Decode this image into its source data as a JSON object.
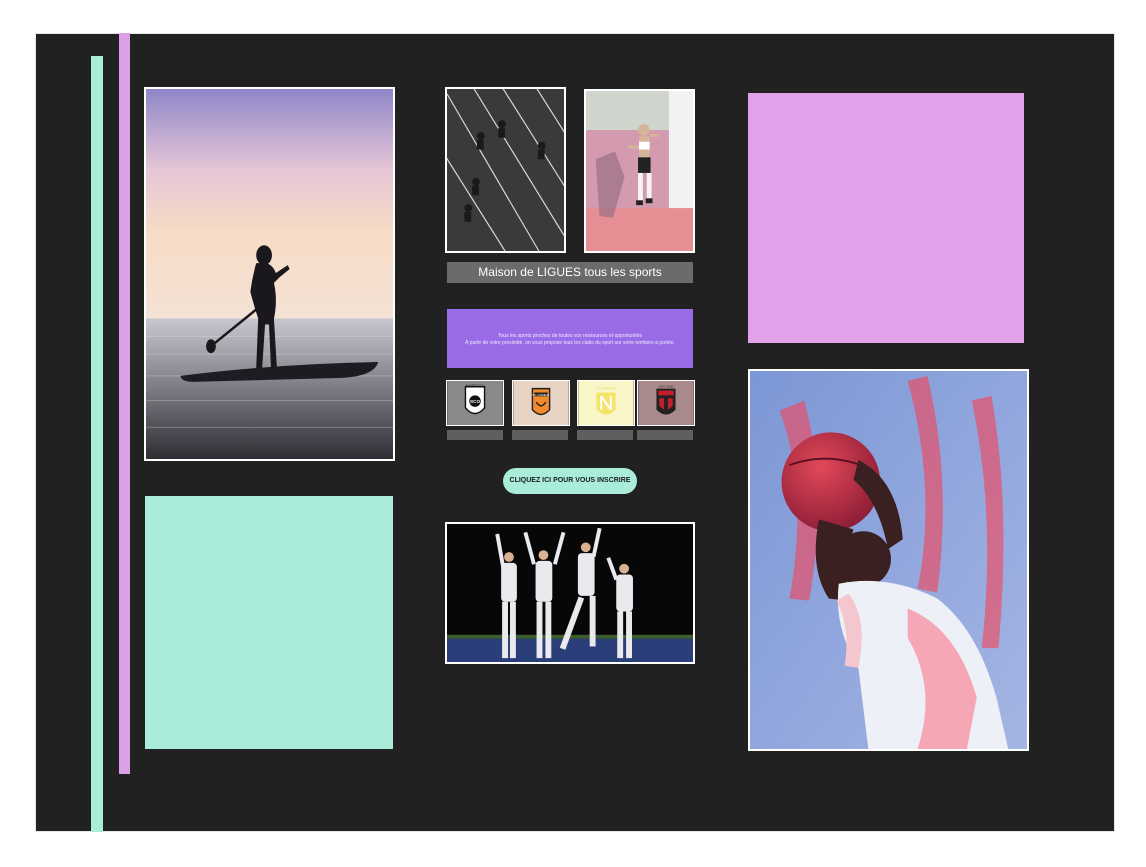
{
  "caption": {
    "text": "Maison de LIGUES tous les sports"
  },
  "info_panel": {
    "line1": "Tous les sports proches de toutes vos ressources et opportunités",
    "line2": "À partir de votre proximité, on vous propose tous les clubs du sport sur votre territoire à portée."
  },
  "club_logos": {
    "angers_text": "ANGERS SCO",
    "lorient_text": "FC LORIENT",
    "nantes_text": "FC NANTES",
    "nice_text": "OGC NICE"
  },
  "cta": {
    "label": "CLIQUEZ ICI POUR VOUS INSCRIRE"
  },
  "colors": {
    "frame_bg": "#212121",
    "mint": "#a8ecd9",
    "pink": "#e2a2ea",
    "purple": "#9a6be6",
    "caption_bg": "#6b6b6b"
  }
}
